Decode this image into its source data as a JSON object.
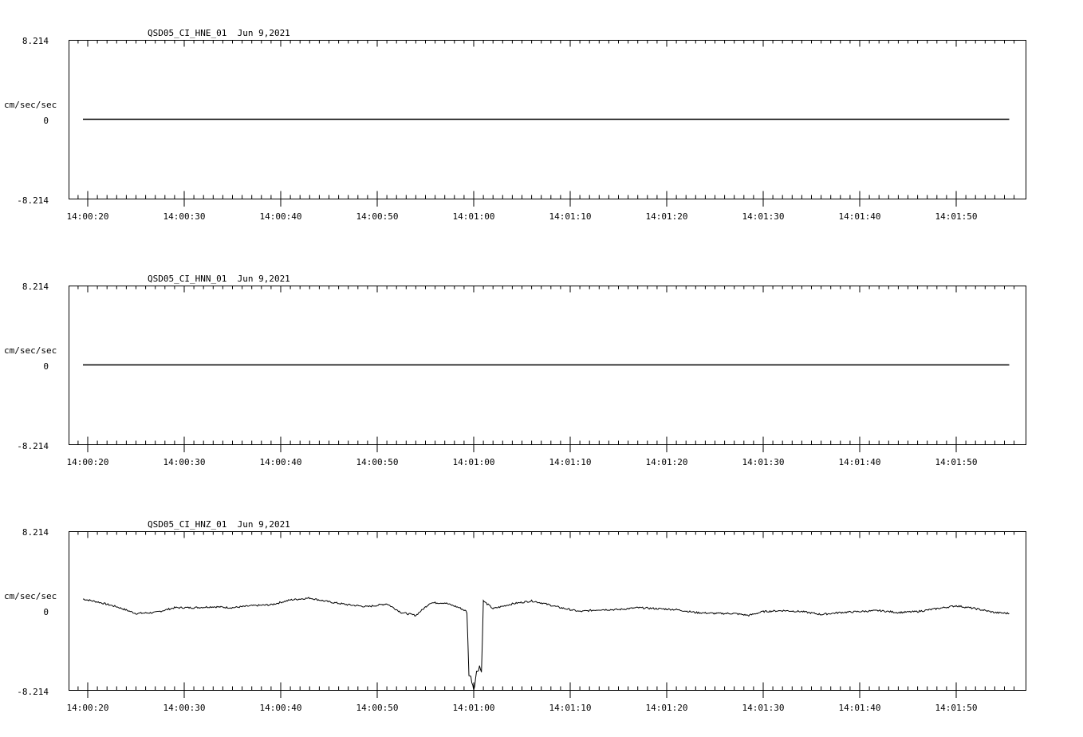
{
  "chart_data": [
    {
      "type": "line",
      "title": "QSD05_CI_HNE_01  Jun 9,2021",
      "ylabel": "cm/sec/sec",
      "yticks": [
        "8.214",
        "0",
        "-8.214"
      ],
      "ylim": [
        -8.214,
        8.214
      ],
      "xticks": [
        "14:00:20",
        "14:00:30",
        "14:00:40",
        "14:00:50",
        "14:01:00",
        "14:01:10",
        "14:01:20",
        "14:01:30",
        "14:01:40",
        "14:01:50"
      ],
      "x_start_label": "14:00:19.5",
      "x_end_label": "14:01:55.5",
      "series": [
        {
          "x": [
            "14:00:19.5",
            "14:01:55.5"
          ],
          "y": [
            0,
            0
          ]
        }
      ]
    },
    {
      "type": "line",
      "title": "QSD05_CI_HNN_01  Jun 9,2021",
      "ylabel": "cm/sec/sec",
      "yticks": [
        "8.214",
        "0",
        "-8.214"
      ],
      "ylim": [
        -8.214,
        8.214
      ],
      "xticks": [
        "14:00:20",
        "14:00:30",
        "14:00:40",
        "14:00:50",
        "14:01:00",
        "14:01:10",
        "14:01:20",
        "14:01:30",
        "14:01:40",
        "14:01:50"
      ],
      "x_start_label": "14:00:19.5",
      "x_end_label": "14:01:55.5",
      "series": [
        {
          "x": [
            "14:00:19.5",
            "14:01:55.5"
          ],
          "y": [
            0,
            0
          ]
        }
      ]
    },
    {
      "type": "line",
      "title": "QSD05_CI_HNZ_01  Jun 9,2021",
      "ylabel": "cm/sec/sec",
      "yticks": [
        "8.214",
        "0",
        "-8.214"
      ],
      "ylim": [
        -8.214,
        8.214
      ],
      "xticks": [
        "14:00:20",
        "14:00:30",
        "14:00:40",
        "14:00:50",
        "14:01:00",
        "14:01:10",
        "14:01:20",
        "14:01:30",
        "14:01:40",
        "14:01:50"
      ],
      "series": [
        {
          "x": [
            "14:00:19.5",
            "14:00:21",
            "14:00:23",
            "14:00:25",
            "14:00:27",
            "14:00:29",
            "14:00:31",
            "14:00:33",
            "14:00:35",
            "14:00:37",
            "14:00:39",
            "14:00:41",
            "14:00:43",
            "14:00:45",
            "14:00:47",
            "14:00:49",
            "14:00:51",
            "14:00:52.5",
            "14:00:54",
            "14:00:55.5",
            "14:00:57",
            "14:00:58.5",
            "14:00:59.3",
            "14:00:59.5",
            "14:00:59.8",
            "14:01:00",
            "14:01:00.3",
            "14:01:00.6",
            "14:01:00.8",
            "14:01:01",
            "14:01:02",
            "14:01:04",
            "14:01:06",
            "14:01:07",
            "14:01:09",
            "14:01:11",
            "14:01:13",
            "14:01:15",
            "14:01:17",
            "14:01:19",
            "14:01:21",
            "14:01:23",
            "14:01:25",
            "14:01:27",
            "14:01:28.5",
            "14:01:30",
            "14:01:32",
            "14:01:34",
            "14:01:36",
            "14:01:38",
            "14:01:40",
            "14:01:42",
            "14:01:44",
            "14:01:46",
            "14:01:48",
            "14:01:50",
            "14:01:52",
            "14:01:54",
            "14:01:55.5"
          ],
          "y": [
            1.2,
            0.9,
            0.4,
            -0.3,
            -0.2,
            0.3,
            0.3,
            0.4,
            0.3,
            0.5,
            0.6,
            1.1,
            1.3,
            0.9,
            0.6,
            0.4,
            0.7,
            -0.2,
            -0.5,
            0.8,
            0.8,
            0.3,
            -0.1,
            -6.5,
            -7.2,
            -8.1,
            -6.4,
            -5.7,
            -6.4,
            1.0,
            0.2,
            0.7,
            1.0,
            0.8,
            0.3,
            -0.1,
            0.1,
            0.1,
            0.3,
            0.2,
            0.1,
            -0.2,
            -0.3,
            -0.3,
            -0.5,
            -0.1,
            0.0,
            -0.1,
            -0.4,
            -0.2,
            -0.1,
            0.0,
            -0.2,
            -0.1,
            0.2,
            0.5,
            0.2,
            -0.2,
            -0.3
          ]
        }
      ]
    }
  ]
}
